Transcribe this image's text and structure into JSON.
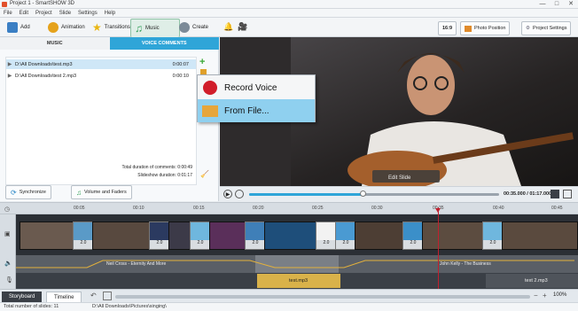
{
  "window": {
    "title": "Project 1 - SmartSHOW 3D",
    "controls": [
      "—",
      "□",
      "✕"
    ]
  },
  "menubar": [
    "File",
    "Edit",
    "Project",
    "Slide",
    "Settings",
    "Help"
  ],
  "toolbar": {
    "add": "Add",
    "animation": "Animation",
    "transitions": "Transitions",
    "music": "Music",
    "create": "Create",
    "aspect": "16:9",
    "photo_position": "Photo Position",
    "project_settings": "Project Settings"
  },
  "tabs": {
    "music": "MUSIC",
    "voice": "VOICE COMMENTS"
  },
  "files": [
    {
      "name": "D:\\All Downloads\\test.mp3",
      "duration": "0:00:07"
    },
    {
      "name": "D:\\All Downloads\\test 2.mp3",
      "duration": "0:00:10"
    }
  ],
  "durations": {
    "comments": "Total duration of comments: 0:00:49",
    "slideshow": "Slideshow duration: 0:01:17"
  },
  "buttons": {
    "synchronize": "Synchronize",
    "volume": "Volume and Faders"
  },
  "context_menu": [
    "Record Voice",
    "From File..."
  ],
  "preview": {
    "edit_slide": "Edit Slide",
    "time": "00:35.000 / 01:17.000"
  },
  "ruler": [
    "00:05",
    "00:10",
    "00:15",
    "00:20",
    "00:25",
    "00:30",
    "00:35",
    "00:40",
    "00:45"
  ],
  "transitions": [
    "2.0",
    "2.0",
    "2.0",
    "2.0",
    "2.0",
    "2.0",
    "2.0",
    "2.0",
    "2.0"
  ],
  "audio_tracks": [
    "Neil Cross - Eternity And More",
    "John Kelly - The Business"
  ],
  "voice_tracks": [
    "test.mp3",
    "text 2.mp3"
  ],
  "bottom_tabs": {
    "storyboard": "Storyboard",
    "timeline": "Timeline"
  },
  "zoom": "100%",
  "status": {
    "slides": "Total number of slides: 11",
    "path": "D:\\All Downloads\\Pictures\\singing\\"
  },
  "colors": {
    "accent": "#2fa5d8",
    "selection": "#cfe7f7",
    "playhead": "#c0202f",
    "voice_track": "#d9b24a"
  }
}
